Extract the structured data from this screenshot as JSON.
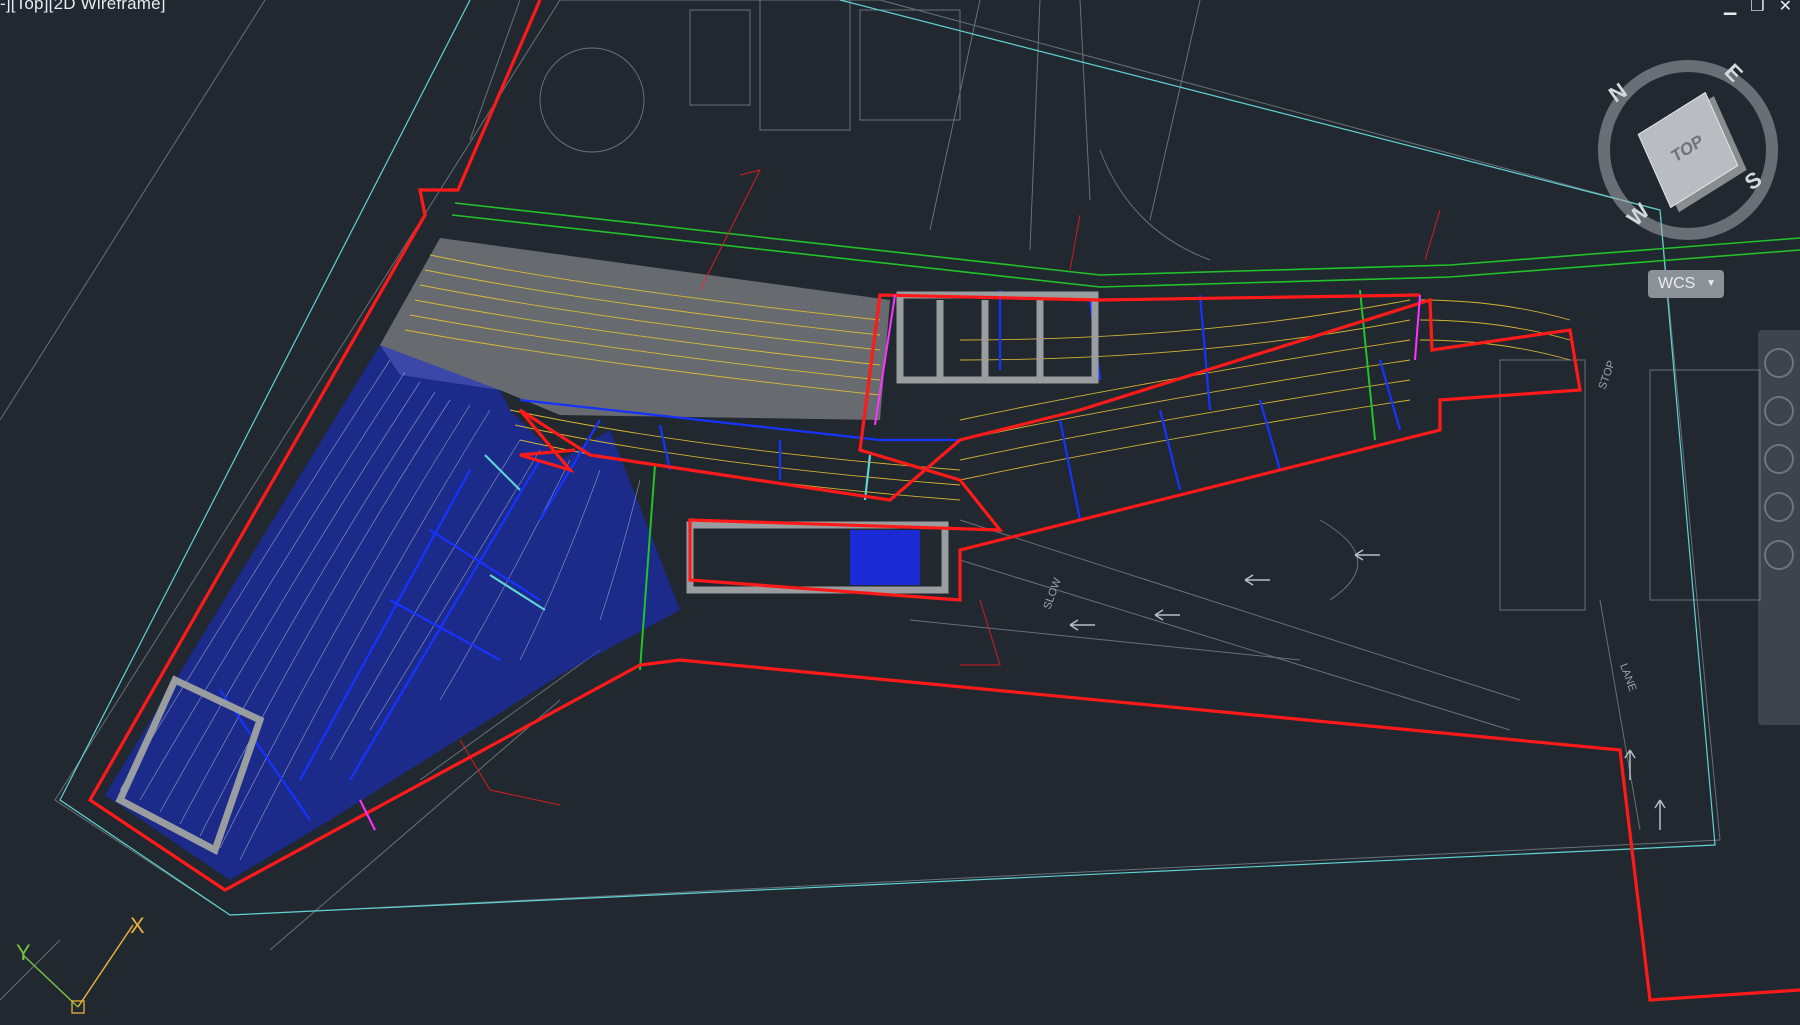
{
  "viewport": {
    "label": "-][Top][2D Wireframe]"
  },
  "window_controls": {
    "minimize": "▁",
    "restore": "❐",
    "close": "✕"
  },
  "viewcube": {
    "face": "TOP",
    "north": "N",
    "east": "E",
    "south": "S",
    "west": "W"
  },
  "ucs_menu": {
    "label": "WCS"
  },
  "ucs_icon": {
    "x_label": "X",
    "y_label": "Y"
  },
  "drawing": {
    "road_text": [
      "STOP",
      "SLOW",
      "LANE"
    ],
    "colors": {
      "background": "#212830",
      "boundary": "#ff1a1a",
      "contour_blue": "#1a2bd6",
      "contour_yellow": "#e6c230",
      "hatch_grey": "#8d8f92",
      "setout_green": "#22c22a",
      "cyan_line": "#5fd3d3",
      "linework_grey": "#7f8890"
    }
  }
}
